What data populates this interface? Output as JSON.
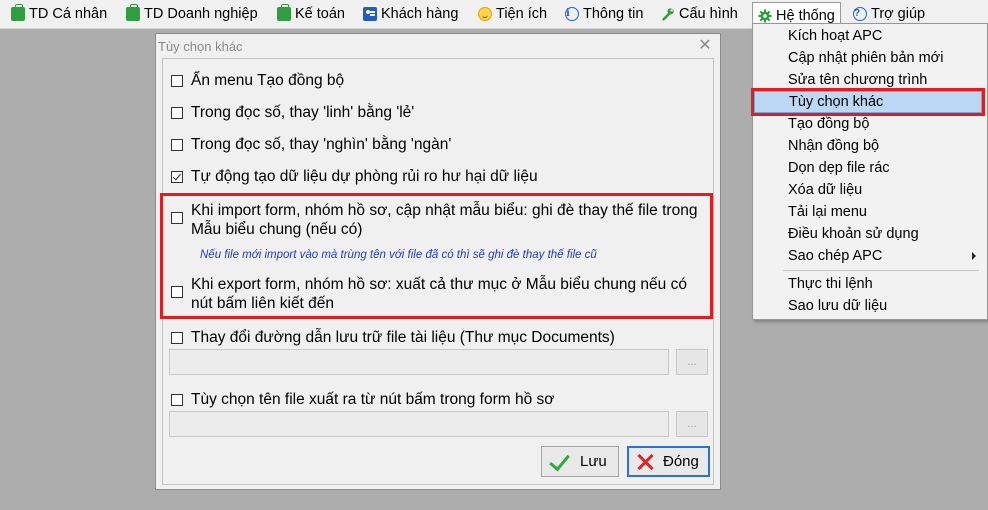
{
  "menubar": {
    "items": [
      {
        "label": "TD Cá nhân",
        "icon": "briefcase-icon"
      },
      {
        "label": "TD Doanh nghiệp",
        "icon": "briefcase-icon"
      },
      {
        "label": "Kế toán",
        "icon": "briefcase-icon"
      },
      {
        "label": "Khách hàng",
        "icon": "contact-card-icon"
      },
      {
        "label": "Tiện ích",
        "icon": "smiley-icon"
      },
      {
        "label": "Thông tin",
        "icon": "info-icon"
      },
      {
        "label": "Cấu hình",
        "icon": "wrench-icon"
      },
      {
        "label": "Hệ thống",
        "icon": "gear-icon"
      },
      {
        "label": "Trợ giúp",
        "icon": "help-icon"
      }
    ]
  },
  "dropdown": {
    "items": [
      "Kích hoạt APC",
      "Cập nhật phiên bản mới",
      "Sửa tên chương trình",
      "Tùy chọn khác",
      "Tạo đồng bộ",
      "Nhận đồng bộ",
      "Dọn dẹp file rác",
      "Xóa dữ liệu",
      "Tải lại menu",
      "Điều khoản sử dụng",
      "Sao chép APC",
      "Thực thi lệnh",
      "Sao lưu dữ liệu"
    ],
    "highlighted": "Tùy chọn khác"
  },
  "dialog": {
    "title": "Tùy chọn khác",
    "options": [
      {
        "label": "Ẩn menu Tạo đồng bộ",
        "checked": false
      },
      {
        "label": "Trong đọc số, thay 'linh' bằng 'lẻ'",
        "checked": false
      },
      {
        "label": "Trong đọc số, thay 'nghìn' bằng 'ngàn'",
        "checked": false
      },
      {
        "label": "Tự động tạo dữ liệu dự phòng rủi ro hư hại dữ liệu",
        "checked": true
      },
      {
        "label": "Khi import form, nhóm hồ sơ, cập nhật mẫu biểu: ghi đè thay thế file trong Mẫu biểu chung (nếu có)",
        "checked": false
      },
      {
        "label": "Khi export form, nhóm hồ sơ: xuất cả thư mục ở Mẫu biểu chung nếu có nút bấm liên kiết đến",
        "checked": false
      },
      {
        "label": "Thay đổi đường dẫn lưu trữ file tài liệu (Thư mục Documents)",
        "checked": false
      },
      {
        "label": "Tùy chọn tên file xuất ra từ nút bấm trong form hồ sơ",
        "checked": false
      }
    ],
    "import_note": "Nếu file mới import vào mà trùng tên với file đã có thì sẽ ghi đè thay thế file cũ",
    "documents_path": "",
    "filename_option_value": "",
    "browse_label": "...",
    "save_label": "Lưu",
    "close_label": "Đóng",
    "colors": {
      "highlight_border": "#e11d1d",
      "note_text": "#1f3bd1",
      "menu_highlight": "#bcd8f5"
    }
  }
}
